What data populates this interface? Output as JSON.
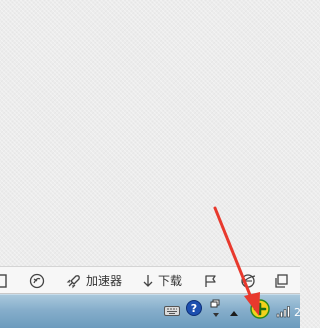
{
  "toolbar": {
    "items": [
      {
        "icon": "window-icon"
      },
      {
        "icon": "refresh-circle-icon"
      },
      {
        "icon": "rocket-icon",
        "label": "加速器"
      },
      {
        "icon": "download-arrow-icon",
        "label": "下载"
      },
      {
        "icon": "flag-icon"
      },
      {
        "icon": "browser-e-icon"
      },
      {
        "icon": "restore-window-icon"
      }
    ]
  },
  "tray": {
    "icons": [
      "keyboard-icon",
      "help-icon",
      "window-switch-icon",
      "show-hidden-icons-arrow",
      "add-circle-icon",
      "signal-bars-icon"
    ],
    "clock_partial": "2"
  },
  "colors": {
    "taskbar_top": "#a9c8dc",
    "taskbar_bottom": "#6c9bbd",
    "highlight_arrow": "#e8392d",
    "add_icon_fill": "#f2d21b"
  }
}
